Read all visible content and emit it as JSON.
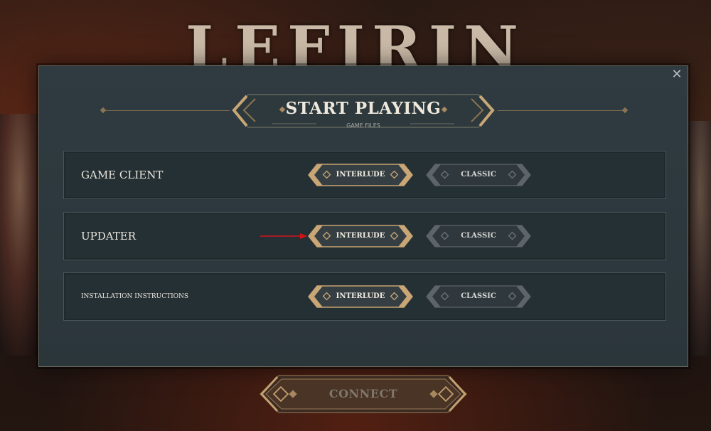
{
  "header": {
    "logo_text": "LEFIRIN"
  },
  "modal": {
    "title": "START PLAYING",
    "subtitle": "GAME FILES",
    "close_label": "✕",
    "rows": [
      {
        "label": "GAME CLIENT",
        "primary": "INTERLUDE",
        "secondary": "CLASSIC"
      },
      {
        "label": "UPDATER",
        "primary": "INTERLUDE",
        "secondary": "CLASSIC"
      },
      {
        "label": "INSTALLATION INSTRUCTIONS",
        "primary": "INTERLUDE",
        "secondary": "CLASSIC"
      }
    ]
  },
  "footer": {
    "connect_label": "CONNECT"
  },
  "colors": {
    "accent_gold": "#b89a6e",
    "arrow_red": "#d0141a",
    "panel": "#2b363b"
  }
}
